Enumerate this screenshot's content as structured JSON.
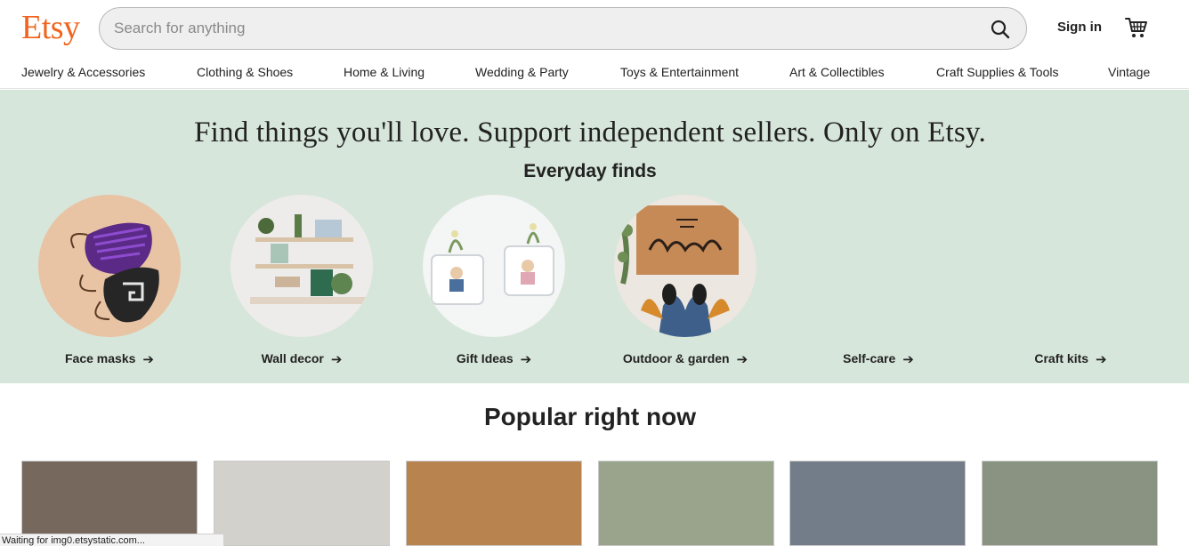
{
  "header": {
    "logo": "Etsy",
    "search_placeholder": "Search for anything",
    "search_value": "",
    "sign_in": "Sign in",
    "brand_color": "#F1641E"
  },
  "categories": [
    "Jewelry & Accessories",
    "Clothing & Shoes",
    "Home & Living",
    "Wedding & Party",
    "Toys & Entertainment",
    "Art & Collectibles",
    "Craft Supplies & Tools",
    "Vintage"
  ],
  "hero": {
    "title": "Find things you'll love. Support independent sellers. Only on Etsy.",
    "subtitle": "Everyday finds",
    "background": "#d7e6da",
    "finds": [
      {
        "label": "Face masks"
      },
      {
        "label": "Wall decor"
      },
      {
        "label": "Gift Ideas"
      },
      {
        "label": "Outdoor & garden"
      },
      {
        "label": "Self-care"
      },
      {
        "label": "Craft kits"
      }
    ]
  },
  "popular": {
    "title": "Popular right now",
    "tile_colors": [
      "#76685d",
      "#d3d1cc",
      "#b9834f",
      "#9aa48c",
      "#737d8a",
      "#8a9381"
    ]
  },
  "status_bar": "Waiting for img0.etsystatic.com..."
}
